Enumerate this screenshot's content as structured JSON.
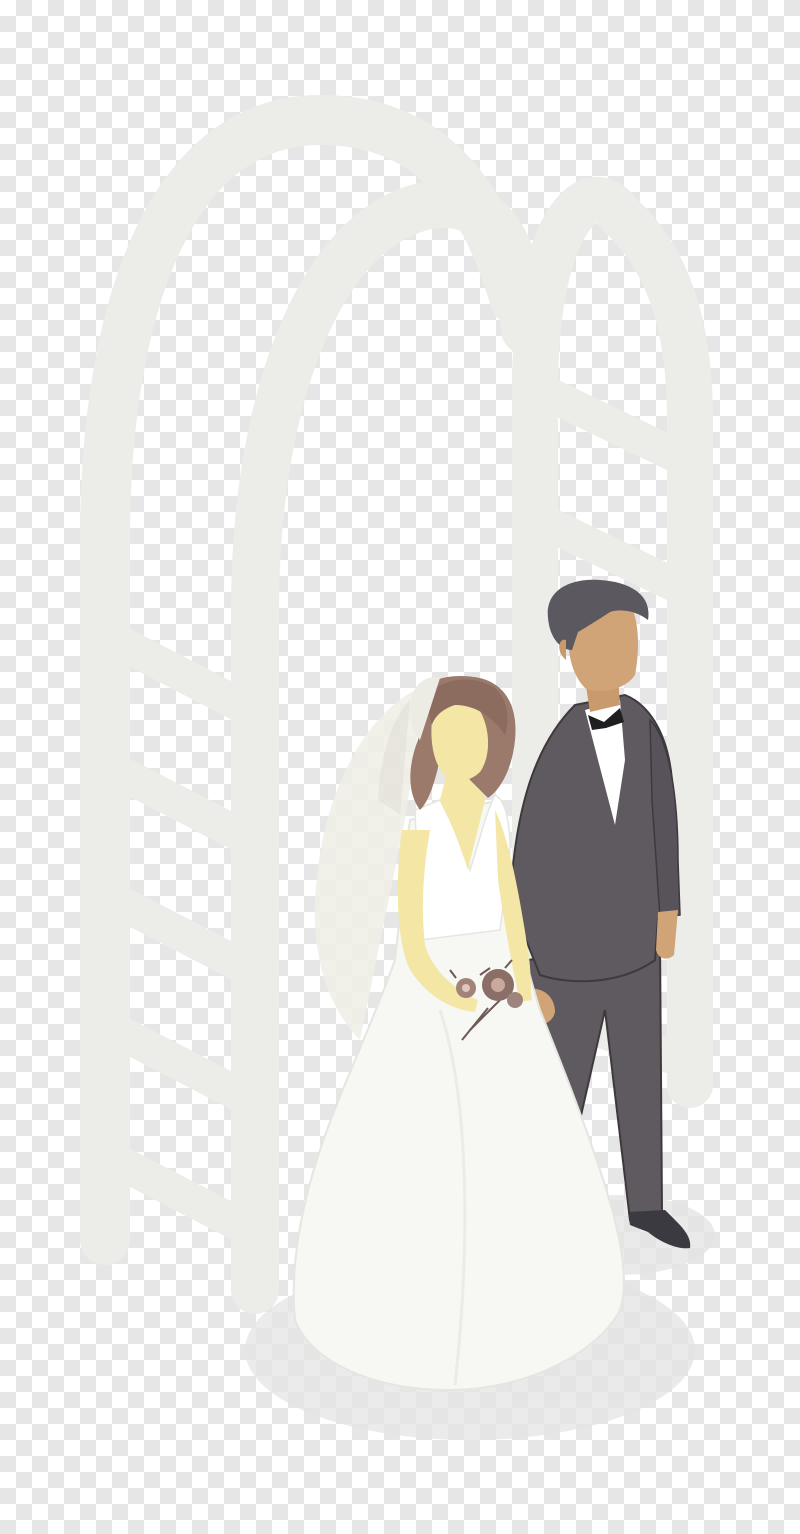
{
  "image": {
    "subject": "wedding-couple-under-arch",
    "background": "transparent-checkerboard"
  },
  "colors": {
    "checker_light": "#ffffff",
    "checker_dark": "#e6e6e6",
    "arch": "#ecece8",
    "shadow": "#e2e2e2",
    "dress": "#f7f7f4",
    "veil": "#ecebe4",
    "bride_skin": "#f4e7a6",
    "bride_hair": "#9b7a6c",
    "suit": "#5f5a60",
    "suit_outline": "#3e393d",
    "groom_skin": "#d1a477",
    "groom_hair": "#5b5860",
    "shirt": "#ffffff",
    "bow_tie": "#1f1f22",
    "bouquet": "#8a6e67",
    "shoe": "#3b3a40"
  },
  "elements": {
    "arch": "garden-arch",
    "bride": "bride-figure",
    "groom": "groom-figure",
    "bouquet": "flower-bouquet"
  }
}
